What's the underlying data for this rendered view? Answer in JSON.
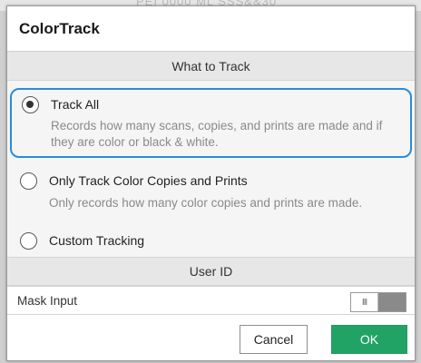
{
  "background": {
    "obscured_text": "PEI 0000 ML SSS&&30"
  },
  "dialog": {
    "title": "ColorTrack",
    "sections": {
      "what_to_track": "What to Track",
      "user_id": "User ID"
    },
    "options": [
      {
        "label": "Track All",
        "description": "Records how many scans, copies, and prints are made and if they are color or black & white.",
        "selected": true
      },
      {
        "label": "Only Track Color Copies and Prints",
        "description": "Only records how many color copies and prints are made.",
        "selected": false
      },
      {
        "label": "Custom Tracking",
        "description": "",
        "selected": false
      }
    ],
    "mask_input": {
      "label": "Mask Input",
      "toggle_glyph": "III",
      "state": "off"
    },
    "buttons": {
      "cancel": "Cancel",
      "ok": "OK"
    }
  },
  "colors": {
    "focus_outline": "#2a8cd9",
    "ok_button": "#21a366",
    "section_header_bg": "#e7e7e7"
  }
}
